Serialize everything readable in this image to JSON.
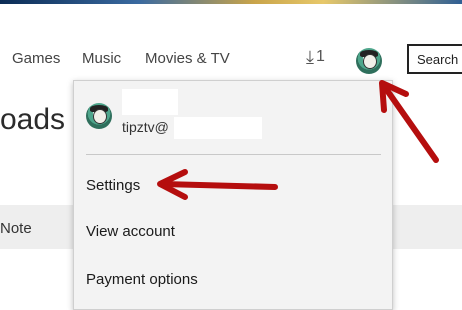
{
  "nav": {
    "items": [
      {
        "label": "Games"
      },
      {
        "label": "Music"
      },
      {
        "label": "Movies & TV"
      }
    ]
  },
  "header": {
    "downloads_icon": "download-arrow-icon",
    "downloads_count": "1",
    "search_label": "Search"
  },
  "page": {
    "heading": "oads"
  },
  "table": {
    "column_header": "Note"
  },
  "account_menu": {
    "email_prefix": "tipztv@",
    "items": [
      {
        "label": "Settings"
      },
      {
        "label": "View account"
      },
      {
        "label": "Payment options"
      }
    ]
  },
  "annotations": {
    "arrow_color": "#b50e0e"
  }
}
